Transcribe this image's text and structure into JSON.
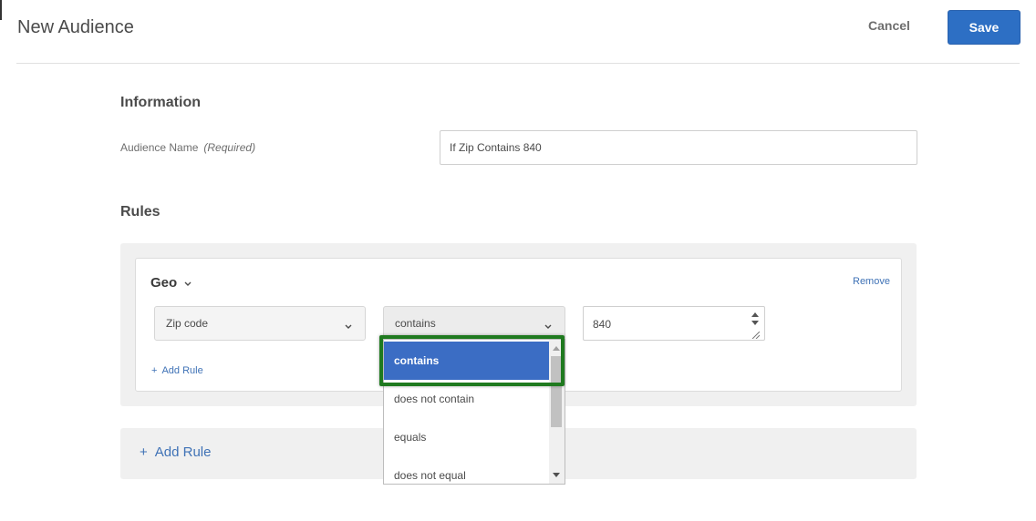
{
  "header": {
    "title": "New Audience",
    "cancel_label": "Cancel",
    "save_label": "Save"
  },
  "information": {
    "section_title": "Information",
    "name_label": "Audience Name",
    "name_required": "(Required)",
    "name_value": "If Zip Contains 840"
  },
  "rules": {
    "section_title": "Rules",
    "group_title": "Geo",
    "remove_label": "Remove",
    "attribute_value": "Zip code",
    "operator_value": "contains",
    "value": "840",
    "add_rule_inner": "Add Rule",
    "add_rule_outer": "Add Rule"
  },
  "operator_dropdown": {
    "options": [
      "contains",
      "does not contain",
      "equals",
      "does not equal"
    ],
    "selected": "contains"
  },
  "colors": {
    "accent": "#2d6fc4",
    "link": "#3f72b6",
    "highlight": "#1f7a1f",
    "selected_option": "#3b6dc4"
  },
  "icons": {
    "geo_toggle": "chevron-down-icon",
    "select_toggle": "chevron-down-icon",
    "add": "plus-icon"
  }
}
